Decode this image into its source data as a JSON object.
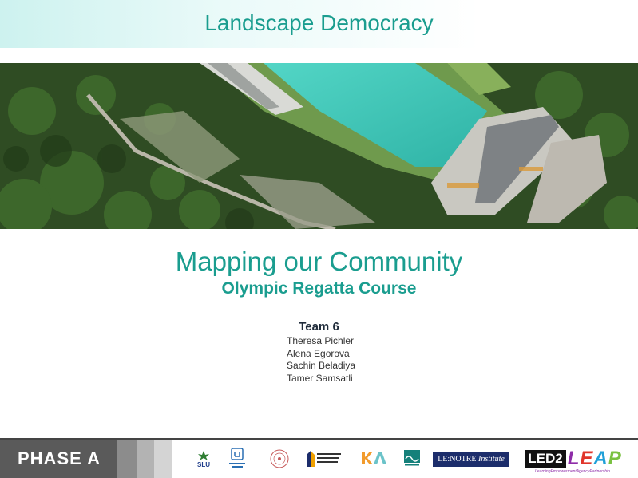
{
  "header": {
    "title": "Landscape Democracy"
  },
  "slide": {
    "main_title": "Mapping our Community",
    "subtitle": "Olympic Regatta Course",
    "team_label": "Team 6",
    "members": [
      "Theresa Pichler",
      "Alena Egorova",
      "Sachin Beladiya",
      "Tamer Samsatli"
    ]
  },
  "footer": {
    "phase_label": "PHASE A",
    "lenotre": {
      "prefix": "LE:NOTRE",
      "suffix": "Institute"
    },
    "led2leap": {
      "led2": "LED2",
      "leap_l": "L",
      "leap_e": "E",
      "leap_a": "A",
      "leap_p": "P",
      "tagline": "LearningEmpowermentAgencyPartnership"
    },
    "slu": {
      "text": "SLU"
    }
  },
  "colors": {
    "accent": "#1a9d8f",
    "water": "#3fc7b8",
    "forest": "#2e4a22"
  }
}
